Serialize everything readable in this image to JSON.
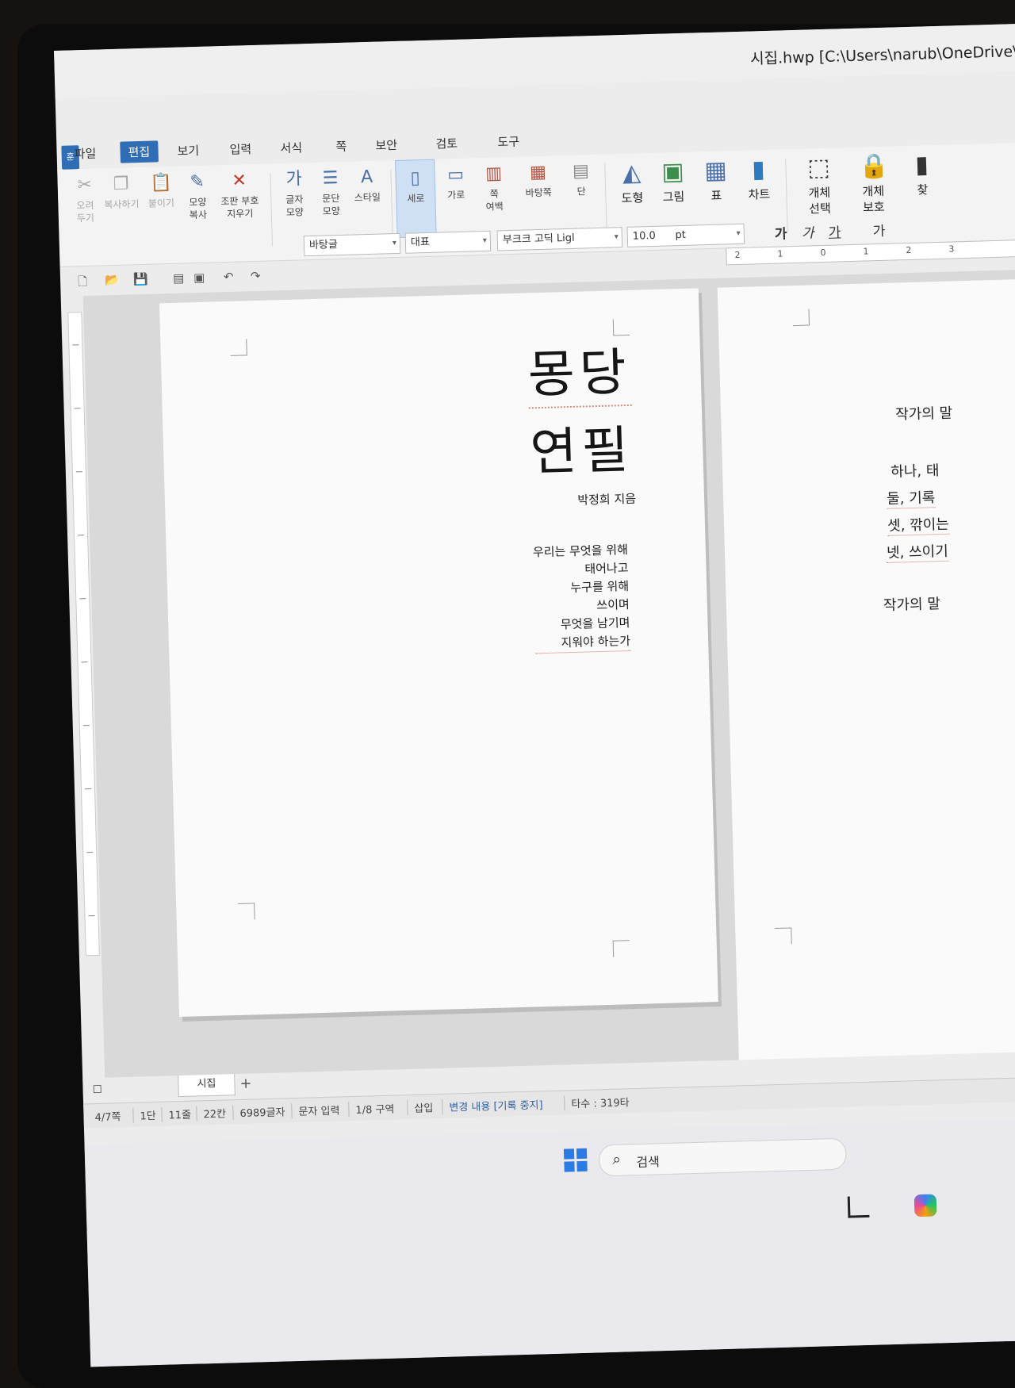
{
  "window": {
    "title": "시집.hwp [C:\\Users\\narub\\OneDrive\\바탕",
    "logo": "훈"
  },
  "menus": [
    "파일",
    "편집",
    "보기",
    "입력",
    "서식",
    "쪽",
    "보안",
    "검토",
    "도구"
  ],
  "active_menu": "편집",
  "ribbon": {
    "cut": "오려\n두기",
    "copy": "복사하기",
    "paste": "붙이기",
    "format_copy": "모양\n복사",
    "clear_marks": "조판 부호\n지우기",
    "char_shape": "글자\n모양",
    "para_shape": "문단\n모양",
    "style": "스타일",
    "portrait": "세로",
    "landscape": "가로",
    "margins": "쪽\n여백",
    "background": "바탕쪽",
    "columns": "단",
    "shapes": "도형",
    "picture": "그림",
    "table": "표",
    "chart": "차트",
    "select_object": "개체\n선택",
    "protect_object": "개체\n보호",
    "find": "찾"
  },
  "format_bar": {
    "style": "바탕글",
    "lang": "대표",
    "font": "부크크 고딕 Ligl",
    "size": "10.0",
    "unit": "pt",
    "bold": "가",
    "italic": "가",
    "underline": "가",
    "strike": "가"
  },
  "ruler": [
    "2",
    "1",
    "0",
    "1",
    "2",
    "3"
  ],
  "page1": {
    "title_line1": "몽당",
    "title_line2": "연필",
    "author": "박정희 지음",
    "poem": [
      "우리는 무엇을 위해",
      "태어나고",
      "누구를 위해",
      "쓰이며",
      "무엇을 남기며",
      "지워야 하는가"
    ]
  },
  "page2": {
    "heading": "작가의 말",
    "items": [
      "하나, 태",
      "둘, 기록",
      "셋, 깎이는",
      "넷, 쓰이기"
    ],
    "footer": "작가의 말"
  },
  "tabs": {
    "sheet": "시집",
    "add": "+"
  },
  "status": {
    "page": "4/7쪽",
    "column": "1단",
    "line": "11줄",
    "col": "22칸",
    "chars": "6989글자",
    "input": "문자 입력",
    "section": "1/8 구역",
    "mode": "삽입",
    "track": "변경 내용 [기록 중지]",
    "typing": "타수 : 319타"
  },
  "taskbar": {
    "search": "검색"
  }
}
